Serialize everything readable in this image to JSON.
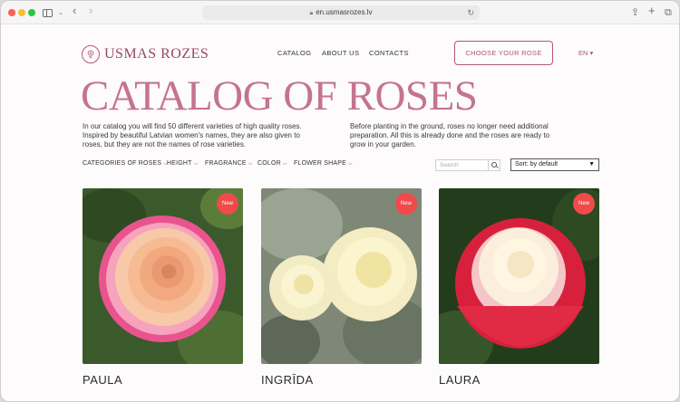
{
  "browser": {
    "url": "en.usmasrozes.lv"
  },
  "header": {
    "logo_text": "USMAS ROZES",
    "nav": [
      {
        "label": "CATALOG"
      },
      {
        "label": "ABOUT US"
      },
      {
        "label": "CONTACTS"
      }
    ],
    "cta_label": "CHOOSE YOUR ROSE",
    "language": "EN ▾"
  },
  "page": {
    "title": "CATALOG OF ROSES",
    "intro_left": "In our catalog you will find 50 different varieties of high quality roses. Inspired by beautiful Latvian women's names, they are also given to roses, but they are not the names of rose varieties.",
    "intro_right": "Before planting in the ground, roses no longer need additional preparation. All this is already done and the roses are ready to grow in your garden."
  },
  "filters": {
    "items": [
      {
        "label": "CATEGORIES OF ROSES"
      },
      {
        "label": "HEIGHT"
      },
      {
        "label": "FRAGRANCE"
      },
      {
        "label": "COLOR"
      },
      {
        "label": "FLOWER SHAPE"
      }
    ],
    "search_placeholder": "Search",
    "sort_label": "Sort: by default"
  },
  "products": [
    {
      "name": "PAULA",
      "badge": "New"
    },
    {
      "name": "INGRĪDA",
      "badge": "New"
    },
    {
      "name": "LAURA",
      "badge": "New"
    }
  ],
  "colors": {
    "brand": "#b4566f",
    "title": "#c4748e",
    "badge": "#f04a4a"
  }
}
